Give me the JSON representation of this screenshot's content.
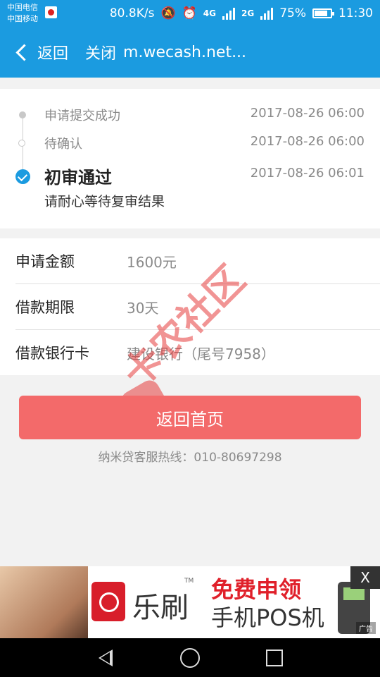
{
  "status_bar": {
    "carrier_1": "中国电信",
    "carrier_2": "中国移动",
    "speed": "80.8K/s",
    "net_1": "4G",
    "net_2": "2G",
    "battery": "75%",
    "time": "11:30",
    "icons": [
      "sim-icon",
      "mute-icon",
      "alarm-icon",
      "signal-icon",
      "battery-icon"
    ]
  },
  "nav": {
    "back_label": "返回",
    "close_label": "关闭",
    "url": "m.wecash.net..."
  },
  "timeline": [
    {
      "label": "申请提交成功",
      "time": "2017-08-26 06:00",
      "state": "done"
    },
    {
      "label": "待确认",
      "time": "2017-08-26 06:00",
      "state": "done"
    },
    {
      "label": "初审通过",
      "time": "2017-08-26 06:01",
      "state": "current",
      "note": "请耐心等待复审结果"
    }
  ],
  "details": [
    {
      "key": "申请金额",
      "value": "1600元"
    },
    {
      "key": "借款期限",
      "value": "30天"
    },
    {
      "key": "借款银行卡",
      "value": "建设银行（尾号7958）"
    }
  ],
  "home_button": "返回首页",
  "hotline": "纳米贷客服热线：010-80697298",
  "watermark": "卡农社区",
  "ad": {
    "brand": "乐刷",
    "tm": "TM",
    "line1": "免费申领",
    "line2": "手机POS机",
    "close": "X",
    "tag": "广告"
  },
  "colors": {
    "primary": "#1b9be0",
    "button": "#f36a6a",
    "watermark": "#e63c3c"
  }
}
